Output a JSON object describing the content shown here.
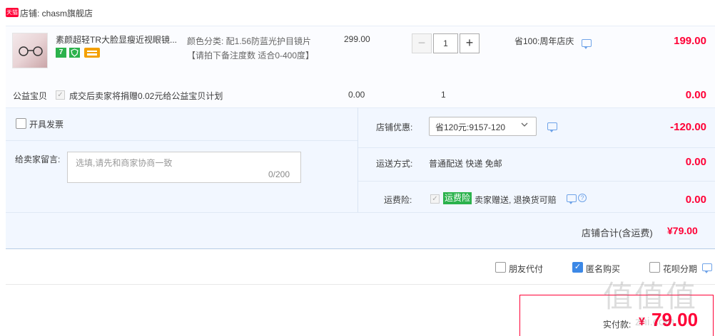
{
  "shop": {
    "badge": "天猫",
    "name": "店铺: chasm旗舰店"
  },
  "item": {
    "title": "素颜超轻TR大脸显瘦近视眼镜...",
    "icon_seven": "7",
    "sku_label": "颜色分类: 配1.56防蓝光护目镜片【请拍下备注度数 适合0-400度】",
    "price": "299.00",
    "quantity": "1",
    "qty_minus": "−",
    "qty_plus": "+",
    "discount_text": "省100:周年店庆",
    "subtotal": "199.00"
  },
  "charity": {
    "label": "公益宝贝",
    "text": "成交后卖家将捐赠0.02元给公益宝贝计划",
    "price": "0.00",
    "qty": "1",
    "subtotal": "0.00"
  },
  "invoice": {
    "label": "开具发票",
    "checked": false
  },
  "message": {
    "label": "给卖家留言:",
    "placeholder": "选填,请先和商家协商一致",
    "count": "0/200"
  },
  "promo": {
    "label": "店铺优惠:",
    "selected": "省120元:9157-120",
    "amount": "-120.00"
  },
  "shipping": {
    "label": "运送方式:",
    "method": "普通配送 快递 免邮",
    "amount": "0.00"
  },
  "insurance": {
    "label": "运费险:",
    "tag": "运费险",
    "text": "卖家赠送, 退换货可赔",
    "amount": "0.00"
  },
  "total": {
    "label": "店铺合计(含运费)",
    "value": "¥79.00"
  },
  "options": {
    "friend_pay": {
      "label": "朋友代付",
      "checked": false
    },
    "anonymous": {
      "label": "匿名购买",
      "checked": true
    },
    "huabei": {
      "label": "花呗分期",
      "checked": false
    }
  },
  "payment": {
    "label": "实付款:",
    "symbol": "¥",
    "value": "79.00"
  },
  "watermark": {
    "main": "值值值",
    "sub": "zhi.com"
  },
  "colors": {
    "accent_red": "#ff0036",
    "link_blue": "#3c88e6",
    "tag_green": "#2bb24c"
  }
}
